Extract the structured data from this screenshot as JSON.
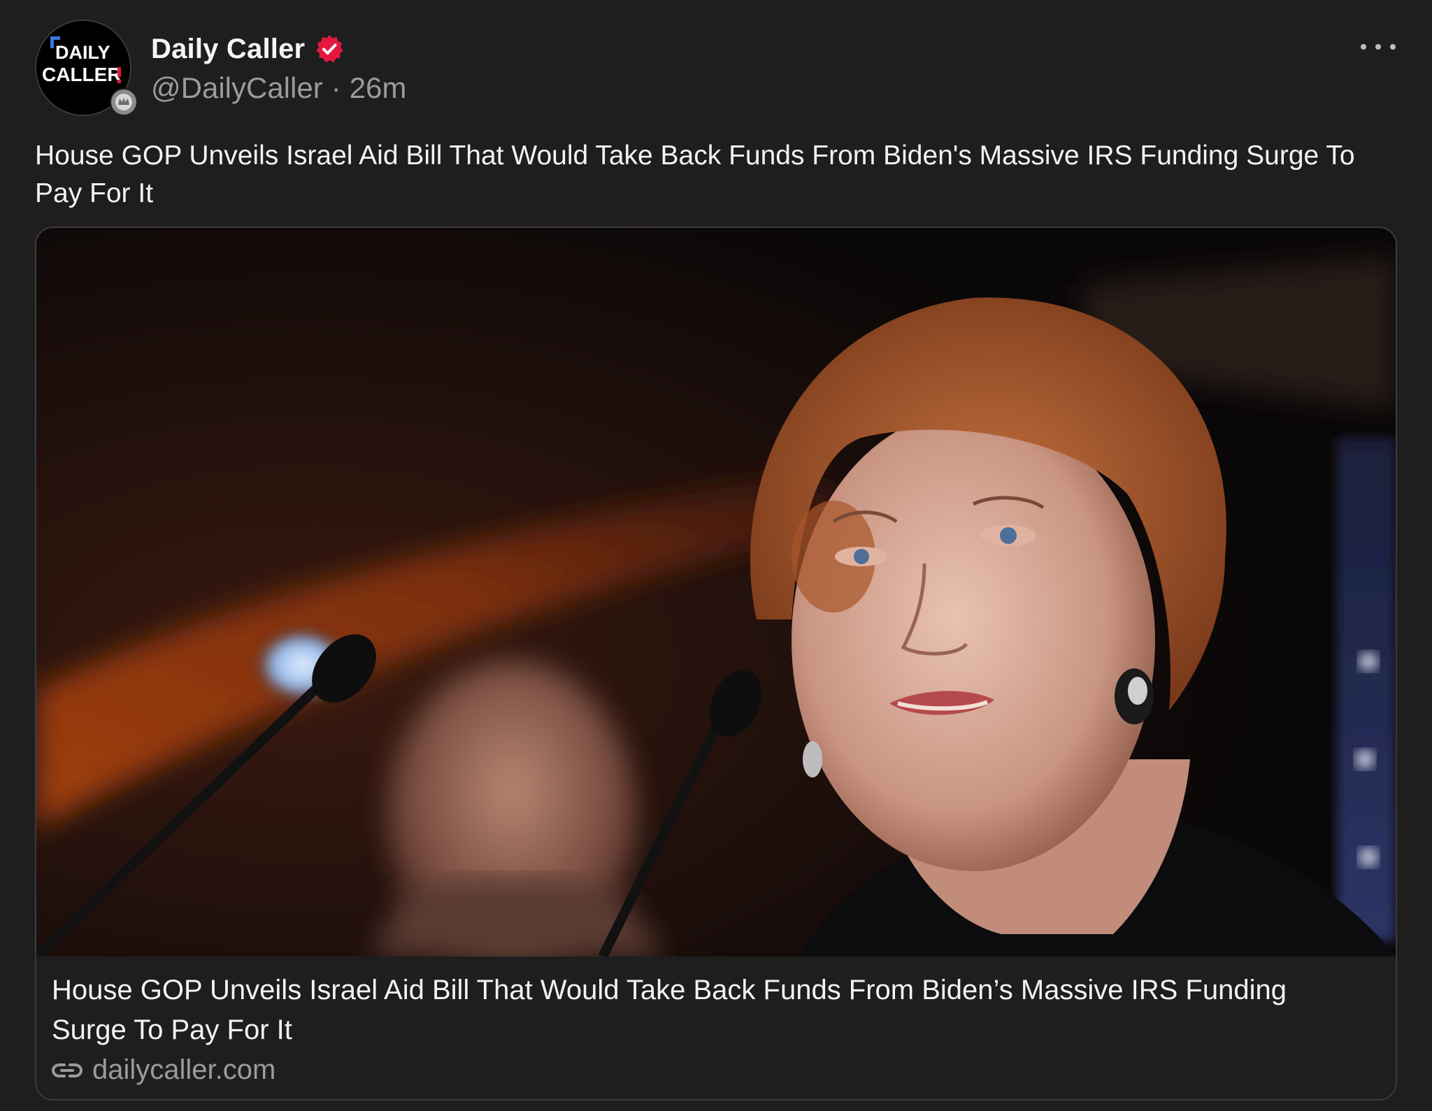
{
  "account": {
    "display_name": "Daily Caller",
    "handle": "@DailyCaller",
    "separator": "·",
    "time_ago": "26m",
    "avatar_logo_text": [
      "DAILY",
      "CALLER"
    ],
    "verified_color": "#e5173f"
  },
  "post": {
    "text": "House GOP Unveils Israel Aid Bill That Would Take Back Funds From Biden's Massive IRS Funding Surge To Pay For It"
  },
  "link_card": {
    "title": "House GOP Unveils Israel Aid Bill That Would Take Back Funds From Biden’s Massive IRS Funding Surge To Pay For It",
    "domain": "dailycaller.com",
    "icon": "link-icon"
  },
  "menu": {
    "icon": "more-options-icon"
  },
  "colors": {
    "background": "#1e1e1f",
    "primary_text": "#f3f3f3",
    "secondary_text": "#9b9b9f",
    "card_border": "#3b3b3e"
  }
}
